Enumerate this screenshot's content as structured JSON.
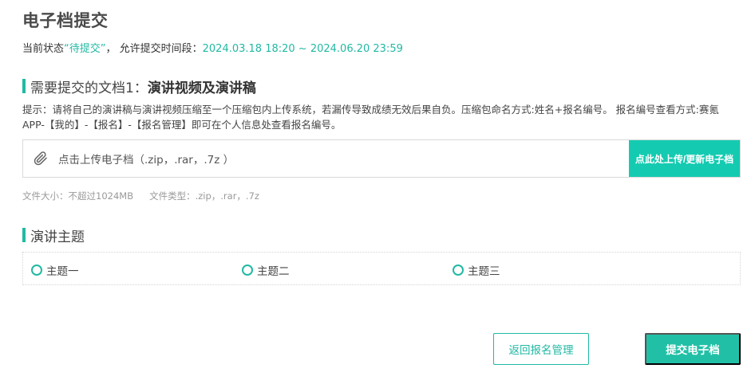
{
  "page": {
    "title": "电子档提交"
  },
  "status": {
    "prefix": "当前状态",
    "value": "“待提交”",
    "middle": "， 允许提交时间段：",
    "period": "2024.03.18 18:20 ~ 2024.06.20 23:59"
  },
  "doc_section": {
    "label_prefix": "需要提交的文档1：",
    "label_name": "演讲视频及演讲稿",
    "hint": "提示：请将自己的演讲稿与演讲视频压缩至一个压缩包内上传系统，若漏传导致成绩无效后果自负。压缩包命名方式:姓名+报名编号。 报名编号查看方式:赛氪APP-【我的】-【报名】-【报名管理】即可在个人信息处查看报名编号。",
    "upload_placeholder": "点击上传电子档（.zip，.rar，.7z ）",
    "upload_button": "点此处上传/更新电子档",
    "file_size": "文件大小：不超过1024MB",
    "file_type": "文件类型：.zip，.rar，.7z"
  },
  "topic_section": {
    "label": "演讲主题",
    "options": [
      "主题一",
      "主题二",
      "主题三"
    ]
  },
  "actions": {
    "back_label": "返回报名管理",
    "submit_label": "提交电子档"
  },
  "colors": {
    "accent": "#21b9a3",
    "upload_button_bg": "#14cbb1"
  },
  "icons": {
    "upload": "paperclip-icon",
    "radio": "radio-circle"
  }
}
